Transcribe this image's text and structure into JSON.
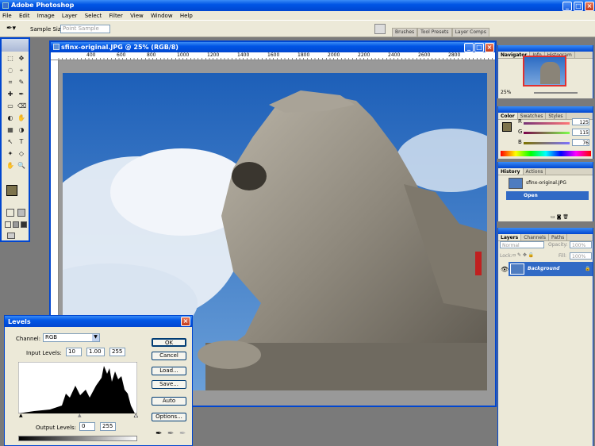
{
  "app": {
    "title": "Adobe Photoshop"
  },
  "menu": [
    "File",
    "Edit",
    "Image",
    "Layer",
    "Select",
    "Filter",
    "View",
    "Window",
    "Help"
  ],
  "options": {
    "sample_size_label": "Sample Size:",
    "sample_size_value": "Point Sample"
  },
  "palette_well": {
    "tabs": [
      "Brushes",
      "Tool Presets",
      "Layer Comps"
    ]
  },
  "document": {
    "title": "sfinx-original.JPG @ 25% (RGB/8)",
    "ruler": [
      "400",
      "600",
      "800",
      "1000",
      "1200",
      "1400",
      "1600",
      "1800",
      "2000",
      "2200",
      "2400",
      "2600",
      "2800"
    ]
  },
  "navigator": {
    "tabs": [
      "Navigator",
      "Info",
      "Histogram"
    ],
    "zoom": "25%"
  },
  "color": {
    "tabs": [
      "Color",
      "Swatches",
      "Styles"
    ],
    "r_label": "R",
    "g_label": "G",
    "b_label": "B",
    "r": "125",
    "g": "115",
    "b": "76",
    "fg": "#7d734c"
  },
  "history": {
    "tabs": [
      "History",
      "Actions"
    ],
    "snapshot": "sfinx-original.JPG",
    "step": "Open"
  },
  "layers": {
    "tabs": [
      "Layers",
      "Channels",
      "Paths"
    ],
    "blend": "Normal",
    "opacity_label": "Opacity:",
    "opacity": "100%",
    "lock_label": "Lock:",
    "fill_label": "Fill:",
    "fill": "100%",
    "layer": "Background"
  },
  "levels": {
    "title": "Levels",
    "channel_label": "Channel:",
    "channel": "RGB",
    "input_label": "Input Levels:",
    "in_black": "10",
    "in_gamma": "1.00",
    "in_white": "255",
    "output_label": "Output Levels:",
    "out_black": "0",
    "out_white": "255",
    "buttons": {
      "ok": "OK",
      "cancel": "Cancel",
      "load": "Load...",
      "save": "Save...",
      "auto": "Auto",
      "options": "Options..."
    }
  }
}
